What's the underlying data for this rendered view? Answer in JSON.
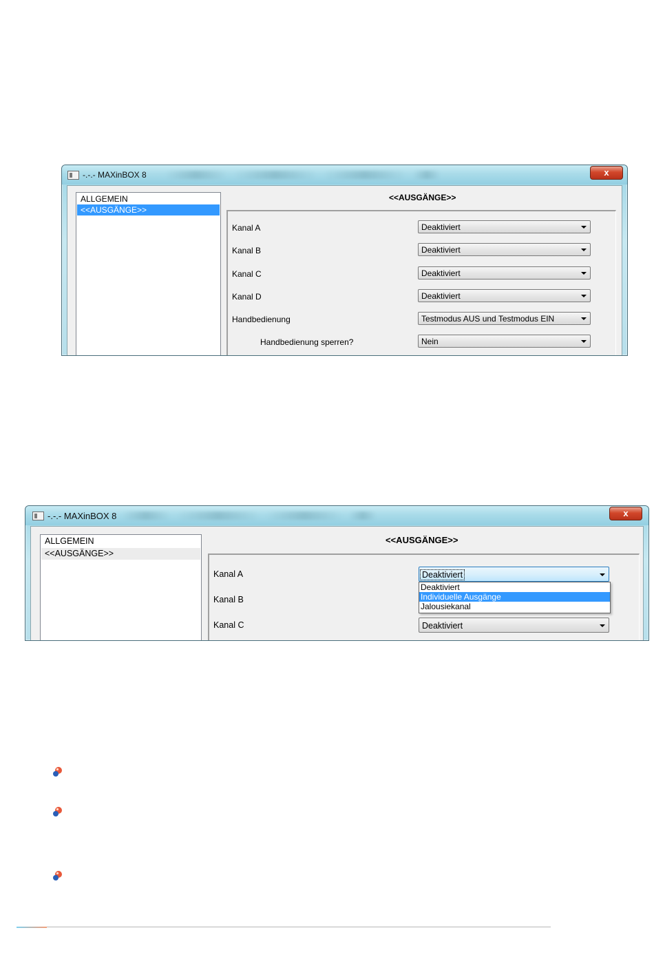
{
  "screen1": {
    "title": "-.-.- MAXinBOX 8",
    "close_glyph": "x",
    "tree": [
      "ALLGEMEIN",
      "<<AUSGÄNGE>>"
    ],
    "heading": "<<AUSGÄNGE>>",
    "rows": [
      {
        "label": "Kanal A",
        "value": "Deaktiviert"
      },
      {
        "label": "Kanal B",
        "value": "Deaktiviert"
      },
      {
        "label": "Kanal C",
        "value": "Deaktiviert"
      },
      {
        "label": "Kanal D",
        "value": "Deaktiviert"
      },
      {
        "label": "Handbedienung",
        "value": "Testmodus AUS und Testmodus EIN"
      },
      {
        "label": "Handbedienung sperren?",
        "value": "Nein"
      }
    ]
  },
  "screen2": {
    "title": "-.-.- MAXinBOX 8",
    "close_glyph": "x",
    "tree": [
      "ALLGEMEIN",
      "<<AUSGÄNGE>>"
    ],
    "heading": "<<AUSGÄNGE>>",
    "rows": [
      {
        "label": "Kanal A",
        "value": "Deaktiviert"
      },
      {
        "label": "Kanal B"
      },
      {
        "label": "Kanal C",
        "value": "Deaktiviert"
      }
    ],
    "dropdown_options": [
      "Deaktiviert",
      "Individuelle Ausgänge",
      "Jalousiekanal"
    ],
    "dropdown_selected": "Individuelle Ausgänge"
  },
  "bullets": {
    "icon": "sphere-bullet-icon",
    "colors": {
      "red": "#e8583a",
      "blue": "#2a5fb8",
      "highlight": "#ffd9c8"
    }
  },
  "colors": {
    "selection": "#3399ff",
    "titlebar": "#a9dbe9",
    "close": "#d2472b",
    "dialog_bg": "#f0f0f0"
  }
}
